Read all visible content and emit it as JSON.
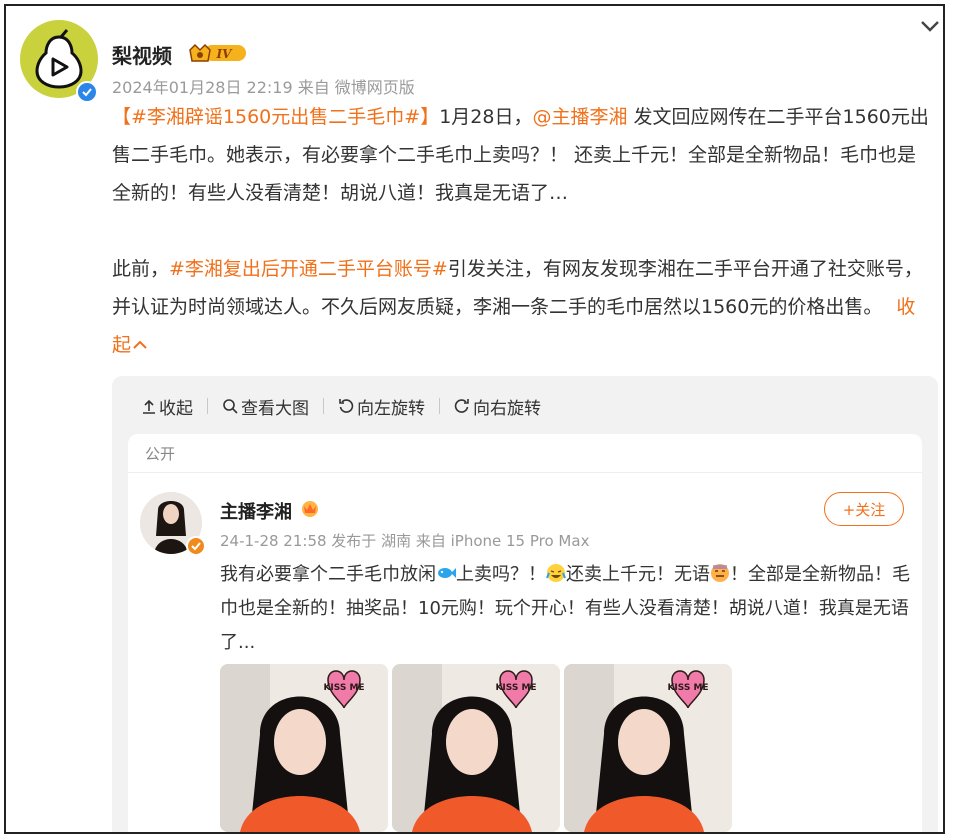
{
  "post": {
    "author": "梨视频",
    "level_badge": "IV",
    "meta": "2024年01月28日 22:19  来自 微博网页版",
    "para1": {
      "hashtag": "【#李湘辟谣1560元出售二手毛巾#】",
      "t1": "1月28日，",
      "mention": "@主播李湘",
      "t2": " 发文回应网传在二手平台1560元出售二手毛巾。她表示，有必要拿个二手毛巾上卖吗？！ 还卖上千元！全部是全新物品！毛巾也是全新的！有些人没看清楚！胡说八道！我真是无语了…"
    },
    "para2": {
      "t1": "此前，",
      "hashtag": "#李湘复出后开通二手平台账号#",
      "t2": "引发关注，有网友发现李湘在二手平台开通了社交账号，并认证为时尚领域达人。不久后网友质疑，李湘一条二手的毛巾居然以1560元的价格出售。",
      "collapse": "收起"
    }
  },
  "toolbar": {
    "collapse": "收起",
    "view_large": "查看大图",
    "rotate_left": "向左旋转",
    "rotate_right": "向右旋转"
  },
  "embedded": {
    "visibility": "公开",
    "author": "主播李湘",
    "meta": "24-1-28 21:58  发布于 湖南  来自 iPhone 15 Pro Max",
    "follow": "+关注",
    "text": {
      "a": "我有必要拿个二手毛巾放闲",
      "b": "上卖吗？！",
      "c": "还卖上千元！无语",
      "d": "！全部是全新物品！毛巾也是全新的！抽奖品！10元购！玩个开心！有些人没看清楚！胡说八道！我真是无语了..."
    },
    "sticker_text": "KISS ME"
  },
  "colors": {
    "accent": "#f1711b",
    "verify_blue": "#2a86e8",
    "avatar_bg": "#c9d13c"
  }
}
